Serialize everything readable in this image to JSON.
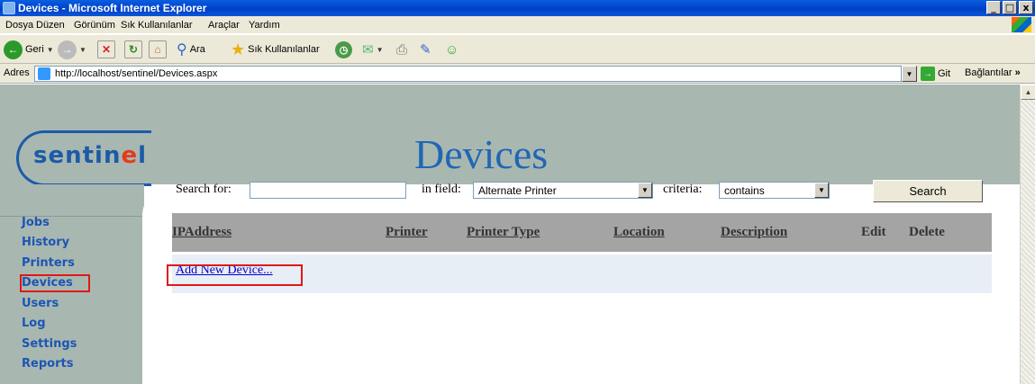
{
  "window": {
    "title": "Devices - Microsoft Internet Explorer",
    "buttons": [
      "_",
      "□",
      "x"
    ]
  },
  "menu": [
    "Dosya",
    "Düzen",
    "Görünüm",
    "Sık Kullanılanlar",
    "Araçlar",
    "Yardım"
  ],
  "toolbar": {
    "back_label": "Geri",
    "search_label": "Ara",
    "favorites_label": "Sık Kullanılanlar"
  },
  "address": {
    "label": "Adres",
    "url": "http://localhost/sentinel/Devices.aspx",
    "go_label": "Git",
    "links_label": "Bağlantılar"
  },
  "logo": {
    "text_a": "sentin",
    "text_b": "e",
    "text_c": "l"
  },
  "page_title": "Devices",
  "nav": [
    "Jobs",
    "History",
    "Printers",
    "Devices",
    "Users",
    "Log",
    "Settings",
    "Reports"
  ],
  "search": {
    "search_for_label": "Search for:",
    "search_value": "",
    "in_field_label": "in field:",
    "field_selected": "Alternate Printer",
    "criteria_label": "criteria:",
    "criteria_selected": "contains",
    "button_label": "Search"
  },
  "grid": {
    "columns": [
      "IPAddress",
      "Printer",
      "Printer Type",
      "Location",
      "Description",
      "Edit",
      "Delete"
    ],
    "add_link": "Add New Device..."
  },
  "colors": {
    "accent": "#1d55b5",
    "sidebar": "#a8b8b0",
    "highlight": "#e01818"
  }
}
